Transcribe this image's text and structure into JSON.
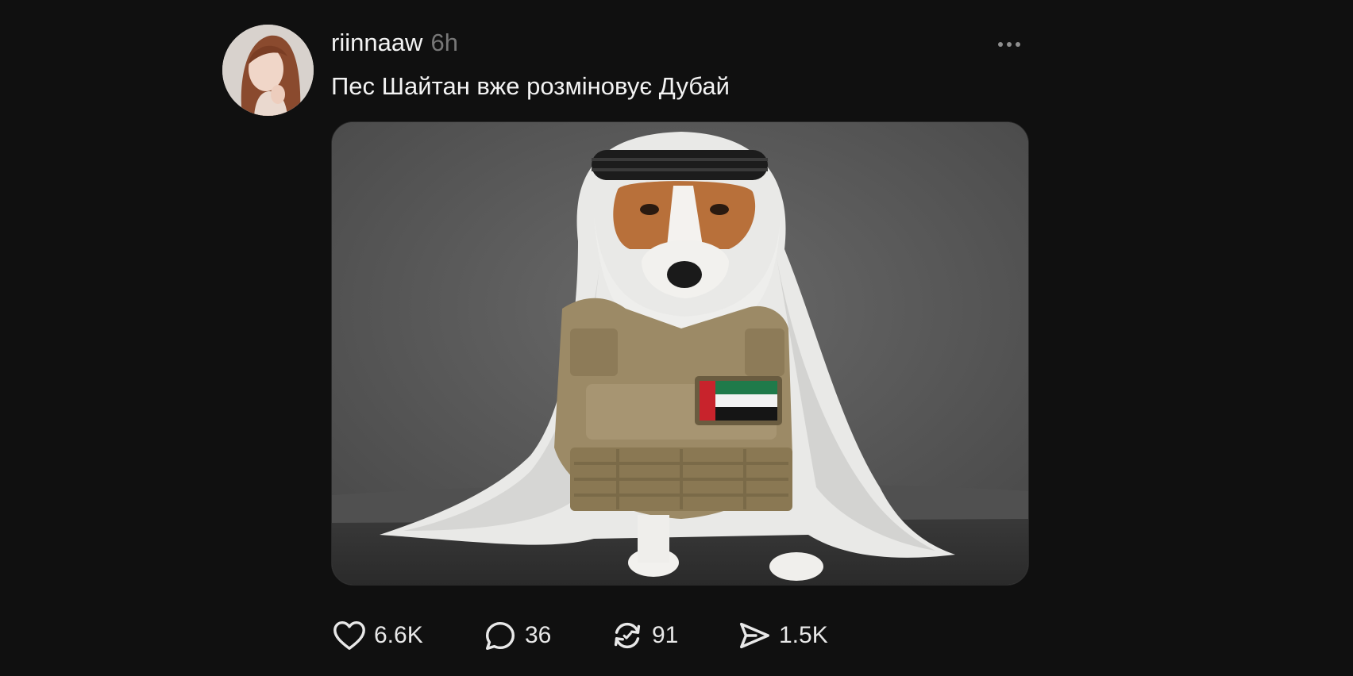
{
  "post": {
    "username": "riinnaaw",
    "timestamp": "6h",
    "caption": "Пес Шайтан вже розміновує Дубай",
    "image_alt": "Jack Russell terrier wearing a white keffiyeh and a tan tactical vest with a UAE flag patch",
    "avatar_icon": "user-avatar-photo",
    "more_icon": "more-horizontal-icon"
  },
  "actions": {
    "likes": "6.6K",
    "replies": "36",
    "reposts": "91",
    "shares": "1.5K",
    "like_icon": "heart-icon",
    "reply_icon": "comment-icon",
    "repost_icon": "repost-icon",
    "share_icon": "send-icon"
  },
  "colors": {
    "background": "#101010",
    "text": "#f3f3f3",
    "muted": "#777777",
    "flag_red": "#c8232c",
    "flag_green": "#1f7a4a"
  }
}
